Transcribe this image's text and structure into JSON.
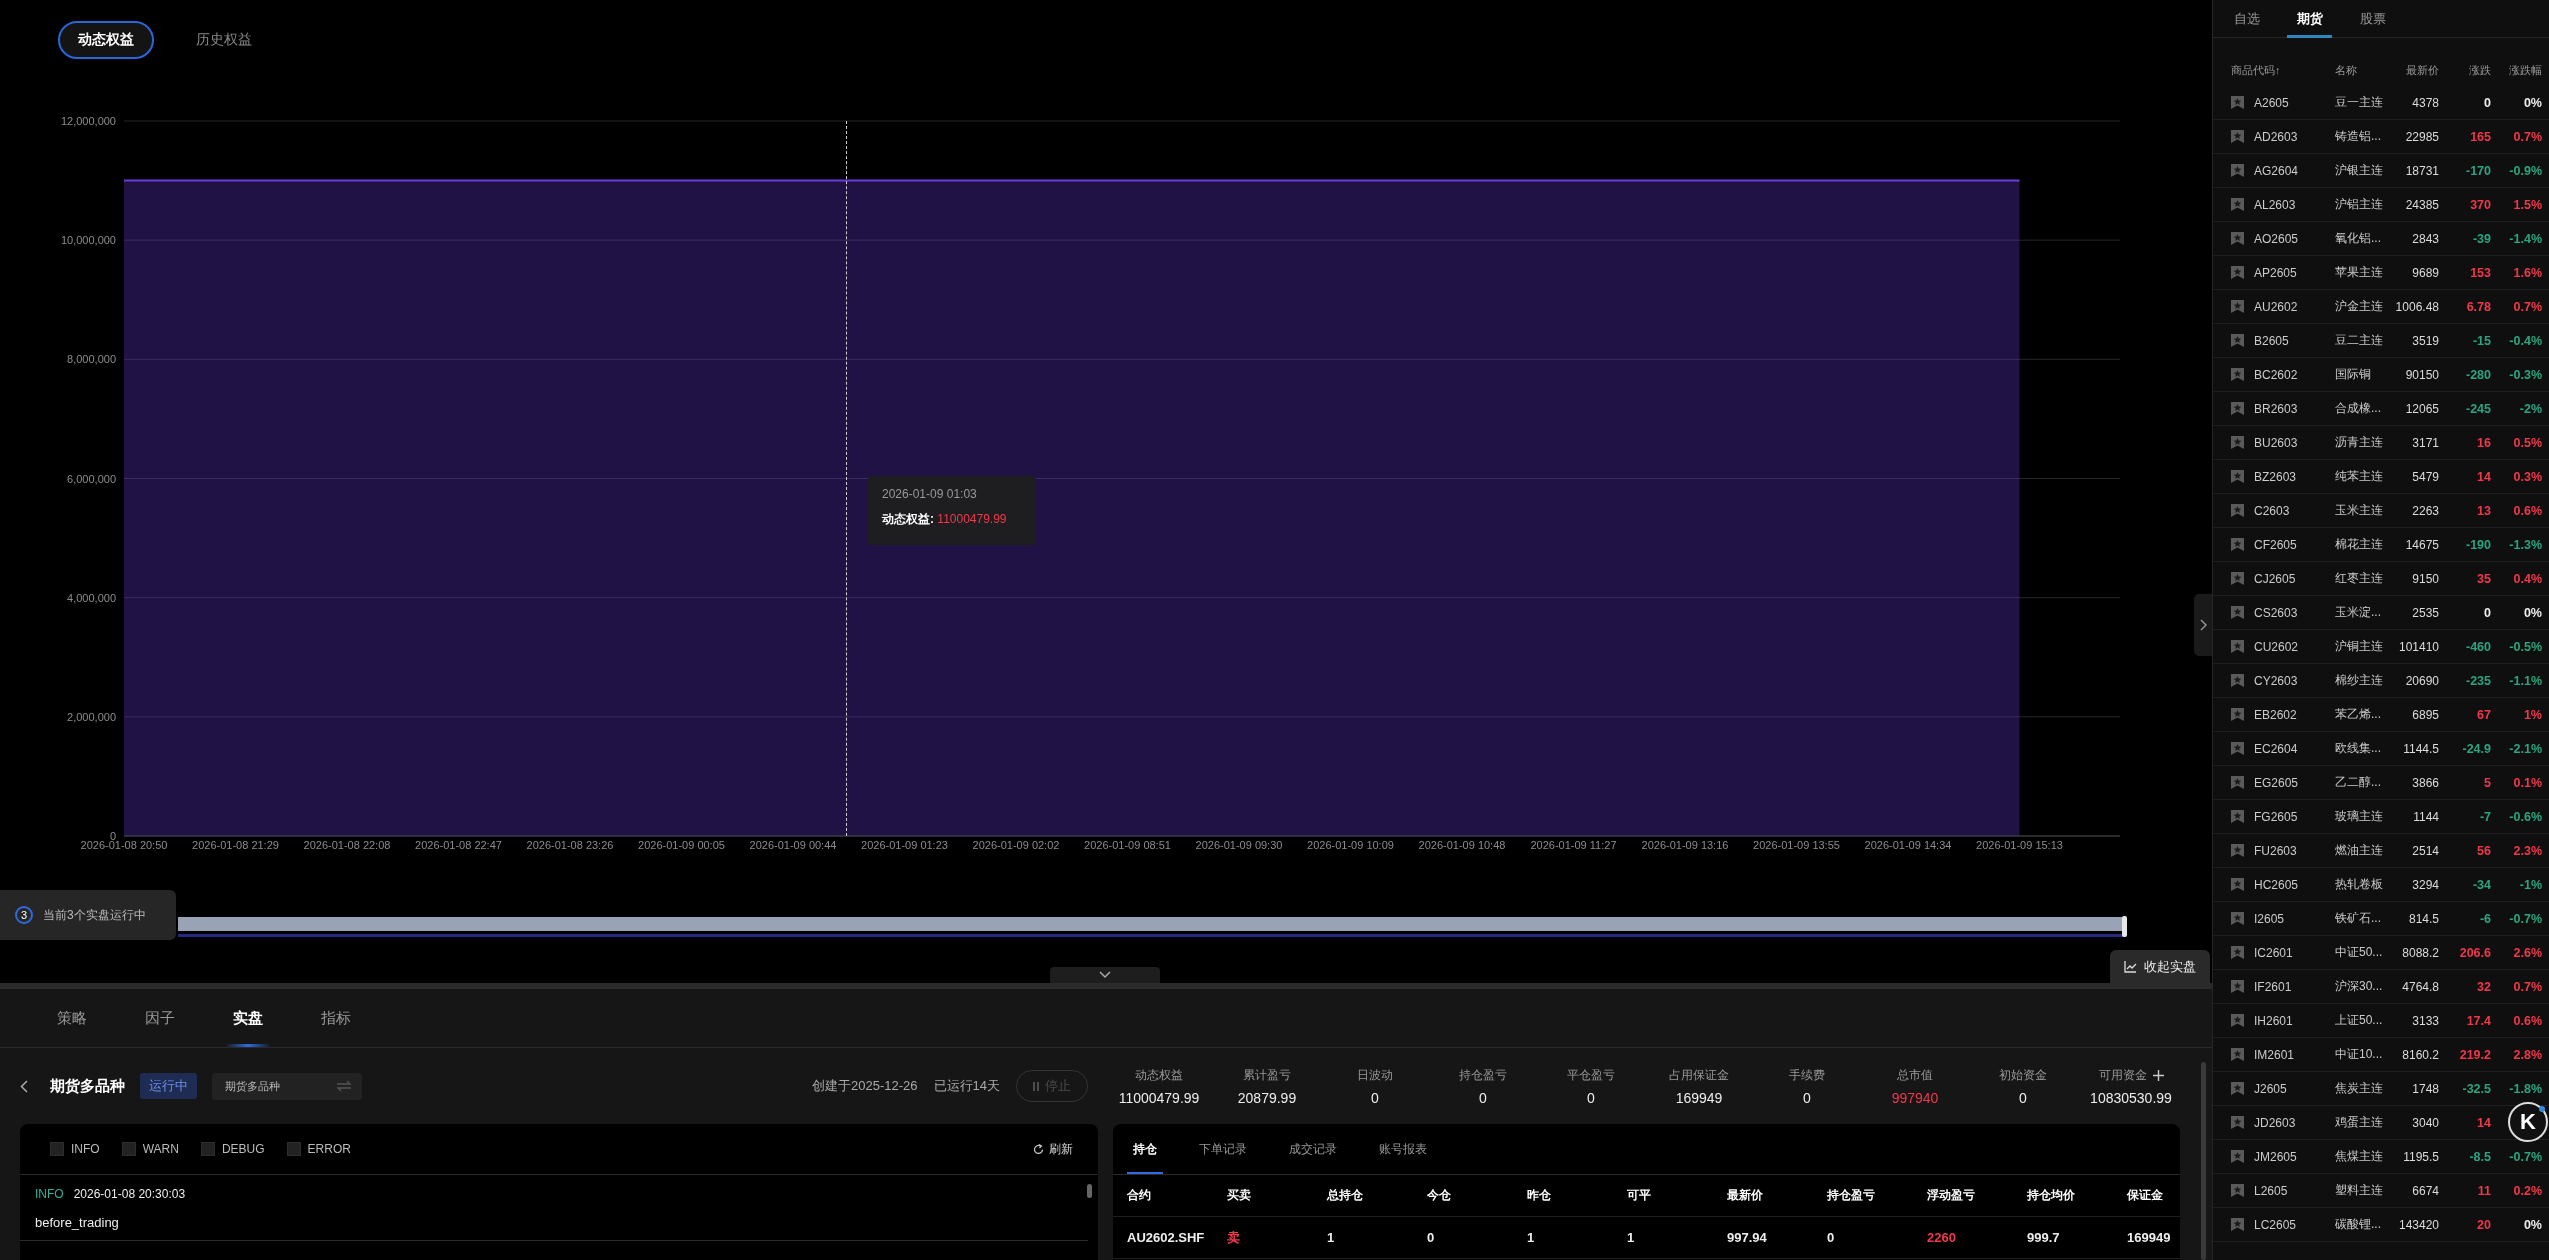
{
  "equity_tabs": [
    {
      "label": "动态权益",
      "selected": true
    },
    {
      "label": "历史权益",
      "selected": false
    }
  ],
  "chart": {
    "chart_data": {
      "type": "area",
      "categories": [
        "2026-01-08 20:50",
        "2026-01-08 21:29",
        "2026-01-08 22:08",
        "2026-01-08 22:47",
        "2026-01-08 23:26",
        "2026-01-09 00:05",
        "2026-01-09 00:44",
        "2026-01-09 01:23",
        "2026-01-09 02:02",
        "2026-01-09 08:51",
        "2026-01-09 09:30",
        "2026-01-09 10:09",
        "2026-01-09 10:48",
        "2026-01-09 11:27",
        "2026-01-09 13:16",
        "2026-01-09 13:55",
        "2026-01-09 14:34",
        "2026-01-09 15:13"
      ],
      "series": [
        {
          "color": "#6a3ce0",
          "values": [
            11000000,
            11000000,
            11000000,
            11000000,
            11000000,
            11000000,
            11000000,
            11000000,
            11000000,
            11000000,
            11000000,
            11000000,
            11000000,
            11000000,
            11000000,
            11000000,
            11000000,
            11000000
          ]
        }
      ],
      "grid": true,
      "ylim": [
        0,
        12000000
      ],
      "yticks": [
        {
          "value": 0,
          "label": "0"
        },
        {
          "value": 2000000,
          "label": "2,000,000"
        },
        {
          "value": 4000000,
          "label": "4,000,000"
        },
        {
          "value": 6000000,
          "label": "6,000,000"
        },
        {
          "value": 8000000,
          "label": "8,000,000"
        },
        {
          "value": 10000000,
          "label": "10,000,000"
        },
        {
          "value": 12000000,
          "label": "12,000,000"
        }
      ]
    },
    "tooltip": {
      "title": "2026-01-09 01:03",
      "label": "动态权益:",
      "value": "11000479.99"
    }
  },
  "running_badge": {
    "count": "3",
    "text": "当前3个实盘运行中"
  },
  "collapse_button": "收起实盘",
  "bottom_tabs": [
    {
      "label": "策略",
      "selected": false
    },
    {
      "label": "因子",
      "selected": false
    },
    {
      "label": "实盘",
      "selected": true
    },
    {
      "label": "指标",
      "selected": false
    }
  ],
  "strategy": {
    "title": "期货多品种",
    "status": "运行中",
    "selector": "期货多品种",
    "created": "创建于2025-12-26",
    "running": "已运行14天",
    "stop_button": {
      "label": "停止",
      "disabled": true
    }
  },
  "log": {
    "filters": [
      {
        "label": "INFO",
        "checked": false
      },
      {
        "label": "WARN",
        "checked": false
      },
      {
        "label": "DEBUG",
        "checked": false
      },
      {
        "label": "ERROR",
        "checked": false
      }
    ],
    "refresh": "刷新",
    "entries": [
      {
        "level": "INFO",
        "time": "2026-01-08 20:30:03",
        "message": "before_trading"
      }
    ]
  },
  "stats": [
    {
      "label": "动态权益",
      "value": "11000479.99",
      "color": "#eeeeee"
    },
    {
      "label": "累计盈亏",
      "value": "20879.99",
      "color": "#eeeeee"
    },
    {
      "label": "日波动",
      "value": "0",
      "color": "#eeeeee"
    },
    {
      "label": "持仓盈亏",
      "value": "0",
      "color": "#eeeeee"
    },
    {
      "label": "平仓盈亏",
      "value": "0",
      "color": "#eeeeee"
    },
    {
      "label": "占用保证金",
      "value": "169949",
      "color": "#eeeeee"
    },
    {
      "label": "手续费",
      "value": "0",
      "color": "#eeeeee"
    },
    {
      "label": "总市值",
      "value": "997940",
      "color": "#f0384b"
    },
    {
      "label": "初始资金",
      "value": "0",
      "color": "#eeeeee"
    },
    {
      "label": "可用资金",
      "value": "10830530.99",
      "color": "#eeeeee"
    }
  ],
  "positions": {
    "tabs": [
      {
        "label": "持仓",
        "selected": true
      },
      {
        "label": "下单记录",
        "selected": false
      },
      {
        "label": "成交记录",
        "selected": false
      },
      {
        "label": "账号报表",
        "selected": false
      }
    ],
    "columns": [
      "合约",
      "买卖",
      "总持仓",
      "今仓",
      "昨仓",
      "可平",
      "最新价",
      "持仓盈亏",
      "浮动盈亏",
      "持仓均价",
      "保证金"
    ],
    "rows": [
      {
        "cells": [
          {
            "text": "AU2602.SHF",
            "color": "#eeeeee"
          },
          {
            "text": "卖",
            "color": "#f0384b"
          },
          {
            "text": "1",
            "color": "#eeeeee"
          },
          {
            "text": "0",
            "color": "#eeeeee"
          },
          {
            "text": "1",
            "color": "#eeeeee"
          },
          {
            "text": "1",
            "color": "#eeeeee"
          },
          {
            "text": "997.94",
            "color": "#eeeeee"
          },
          {
            "text": "0",
            "color": "#eeeeee"
          },
          {
            "text": "2260",
            "color": "#f0384b"
          },
          {
            "text": "999.7",
            "color": "#eeeeee"
          },
          {
            "text": "169949",
            "color": "#eeeeee"
          }
        ]
      }
    ]
  },
  "market": {
    "tabs": [
      {
        "label": "自选",
        "selected": false
      },
      {
        "label": "期货",
        "selected": true
      },
      {
        "label": "股票",
        "selected": false
      }
    ],
    "columns": [
      "商品代码↑",
      "名称",
      "最新价",
      "涨跌",
      "涨跌幅"
    ],
    "rows": [
      {
        "code": "A2605",
        "name": "豆一主连",
        "price": "4378",
        "change": {
          "text": "0",
          "color": "#eeeeee"
        },
        "pct": {
          "text": "0%",
          "color": "#eeeeee"
        }
      },
      {
        "code": "AD2603",
        "name": "铸造铝...",
        "price": "22985",
        "change": {
          "text": "165",
          "color": "#f0384b"
        },
        "pct": {
          "text": "0.7%",
          "color": "#f0384b"
        }
      },
      {
        "code": "AG2604",
        "name": "沪银主连",
        "price": "18731",
        "change": {
          "text": "-170",
          "color": "#2aa57f"
        },
        "pct": {
          "text": "-0.9%",
          "color": "#2aa57f"
        }
      },
      {
        "code": "AL2603",
        "name": "沪铝主连",
        "price": "24385",
        "change": {
          "text": "370",
          "color": "#f0384b"
        },
        "pct": {
          "text": "1.5%",
          "color": "#f0384b"
        }
      },
      {
        "code": "AO2605",
        "name": "氧化铝...",
        "price": "2843",
        "change": {
          "text": "-39",
          "color": "#2aa57f"
        },
        "pct": {
          "text": "-1.4%",
          "color": "#2aa57f"
        }
      },
      {
        "code": "AP2605",
        "name": "苹果主连",
        "price": "9689",
        "change": {
          "text": "153",
          "color": "#f0384b"
        },
        "pct": {
          "text": "1.6%",
          "color": "#f0384b"
        }
      },
      {
        "code": "AU2602",
        "name": "沪金主连",
        "price": "1006.48",
        "change": {
          "text": "6.78",
          "color": "#f0384b"
        },
        "pct": {
          "text": "0.7%",
          "color": "#f0384b"
        }
      },
      {
        "code": "B2605",
        "name": "豆二主连",
        "price": "3519",
        "change": {
          "text": "-15",
          "color": "#2aa57f"
        },
        "pct": {
          "text": "-0.4%",
          "color": "#2aa57f"
        }
      },
      {
        "code": "BC2602",
        "name": "国际铜",
        "price": "90150",
        "change": {
          "text": "-280",
          "color": "#2aa57f"
        },
        "pct": {
          "text": "-0.3%",
          "color": "#2aa57f"
        }
      },
      {
        "code": "BR2603",
        "name": "合成橡...",
        "price": "12065",
        "change": {
          "text": "-245",
          "color": "#2aa57f"
        },
        "pct": {
          "text": "-2%",
          "color": "#2aa57f"
        }
      },
      {
        "code": "BU2603",
        "name": "沥青主连",
        "price": "3171",
        "change": {
          "text": "16",
          "color": "#f0384b"
        },
        "pct": {
          "text": "0.5%",
          "color": "#f0384b"
        }
      },
      {
        "code": "BZ2603",
        "name": "纯苯主连",
        "price": "5479",
        "change": {
          "text": "14",
          "color": "#f0384b"
        },
        "pct": {
          "text": "0.3%",
          "color": "#f0384b"
        }
      },
      {
        "code": "C2603",
        "name": "玉米主连",
        "price": "2263",
        "change": {
          "text": "13",
          "color": "#f0384b"
        },
        "pct": {
          "text": "0.6%",
          "color": "#f0384b"
        }
      },
      {
        "code": "CF2605",
        "name": "棉花主连",
        "price": "14675",
        "change": {
          "text": "-190",
          "color": "#2aa57f"
        },
        "pct": {
          "text": "-1.3%",
          "color": "#2aa57f"
        }
      },
      {
        "code": "CJ2605",
        "name": "红枣主连",
        "price": "9150",
        "change": {
          "text": "35",
          "color": "#f0384b"
        },
        "pct": {
          "text": "0.4%",
          "color": "#f0384b"
        }
      },
      {
        "code": "CS2603",
        "name": "玉米淀...",
        "price": "2535",
        "change": {
          "text": "0",
          "color": "#eeeeee"
        },
        "pct": {
          "text": "0%",
          "color": "#eeeeee"
        }
      },
      {
        "code": "CU2602",
        "name": "沪铜主连",
        "price": "101410",
        "change": {
          "text": "-460",
          "color": "#2aa57f"
        },
        "pct": {
          "text": "-0.5%",
          "color": "#2aa57f"
        }
      },
      {
        "code": "CY2603",
        "name": "棉纱主连",
        "price": "20690",
        "change": {
          "text": "-235",
          "color": "#2aa57f"
        },
        "pct": {
          "text": "-1.1%",
          "color": "#2aa57f"
        }
      },
      {
        "code": "EB2602",
        "name": "苯乙烯...",
        "price": "6895",
        "change": {
          "text": "67",
          "color": "#f0384b"
        },
        "pct": {
          "text": "1%",
          "color": "#f0384b"
        }
      },
      {
        "code": "EC2604",
        "name": "欧线集...",
        "price": "1144.5",
        "change": {
          "text": "-24.9",
          "color": "#2aa57f"
        },
        "pct": {
          "text": "-2.1%",
          "color": "#2aa57f"
        }
      },
      {
        "code": "EG2605",
        "name": "乙二醇...",
        "price": "3866",
        "change": {
          "text": "5",
          "color": "#f0384b"
        },
        "pct": {
          "text": "0.1%",
          "color": "#f0384b"
        }
      },
      {
        "code": "FG2605",
        "name": "玻璃主连",
        "price": "1144",
        "change": {
          "text": "-7",
          "color": "#2aa57f"
        },
        "pct": {
          "text": "-0.6%",
          "color": "#2aa57f"
        }
      },
      {
        "code": "FU2603",
        "name": "燃油主连",
        "price": "2514",
        "change": {
          "text": "56",
          "color": "#f0384b"
        },
        "pct": {
          "text": "2.3%",
          "color": "#f0384b"
        }
      },
      {
        "code": "HC2605",
        "name": "热轧卷板",
        "price": "3294",
        "change": {
          "text": "-34",
          "color": "#2aa57f"
        },
        "pct": {
          "text": "-1%",
          "color": "#2aa57f"
        }
      },
      {
        "code": "I2605",
        "name": "铁矿石...",
        "price": "814.5",
        "change": {
          "text": "-6",
          "color": "#2aa57f"
        },
        "pct": {
          "text": "-0.7%",
          "color": "#2aa57f"
        }
      },
      {
        "code": "IC2601",
        "name": "中证50...",
        "price": "8088.2",
        "change": {
          "text": "206.6",
          "color": "#f0384b"
        },
        "pct": {
          "text": "2.6%",
          "color": "#f0384b"
        }
      },
      {
        "code": "IF2601",
        "name": "沪深30...",
        "price": "4764.8",
        "change": {
          "text": "32",
          "color": "#f0384b"
        },
        "pct": {
          "text": "0.7%",
          "color": "#f0384b"
        }
      },
      {
        "code": "IH2601",
        "name": "上证50...",
        "price": "3133",
        "change": {
          "text": "17.4",
          "color": "#f0384b"
        },
        "pct": {
          "text": "0.6%",
          "color": "#f0384b"
        }
      },
      {
        "code": "IM2601",
        "name": "中证10...",
        "price": "8160.2",
        "change": {
          "text": "219.2",
          "color": "#f0384b"
        },
        "pct": {
          "text": "2.8%",
          "color": "#f0384b"
        }
      },
      {
        "code": "J2605",
        "name": "焦炭主连",
        "price": "1748",
        "change": {
          "text": "-32.5",
          "color": "#2aa57f"
        },
        "pct": {
          "text": "-1.8%",
          "color": "#2aa57f"
        }
      },
      {
        "code": "JD2603",
        "name": "鸡蛋主连",
        "price": "3040",
        "change": {
          "text": "14",
          "color": "#f0384b"
        }
      },
      {
        "code": "JM2605",
        "name": "焦煤主连",
        "price": "1195.5",
        "change": {
          "text": "-8.5",
          "color": "#2aa57f"
        },
        "pct": {
          "text": "-0.7%",
          "color": "#2aa57f"
        }
      },
      {
        "code": "L2605",
        "name": "塑料主连",
        "price": "6674",
        "change": {
          "text": "11",
          "color": "#f0384b"
        },
        "pct": {
          "text": "0.2%",
          "color": "#f0384b"
        }
      },
      {
        "code": "LC2605",
        "name": "碳酸锂...",
        "price": "143420",
        "change": {
          "text": "20",
          "color": "#f0384b"
        },
        "pct": {
          "text": "0%",
          "color": "#eeeeee"
        }
      }
    ]
  },
  "floating_button": "K"
}
